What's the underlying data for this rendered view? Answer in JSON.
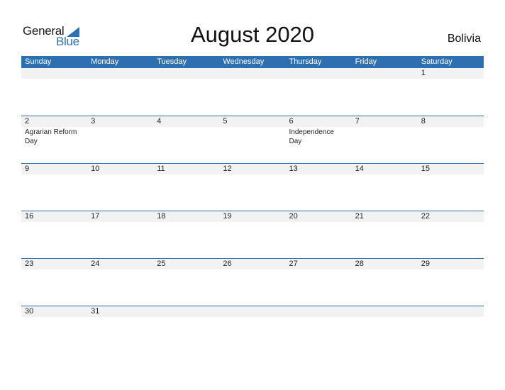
{
  "brand": {
    "word1": "General",
    "word2": "Blue",
    "accent": "#2e6fb2"
  },
  "title": "August 2020",
  "country": "Bolivia",
  "weekdays": [
    "Sunday",
    "Monday",
    "Tuesday",
    "Wednesday",
    "Thursday",
    "Friday",
    "Saturday"
  ],
  "weeks": [
    {
      "days": [
        {
          "num": "",
          "event": ""
        },
        {
          "num": "",
          "event": ""
        },
        {
          "num": "",
          "event": ""
        },
        {
          "num": "",
          "event": ""
        },
        {
          "num": "",
          "event": ""
        },
        {
          "num": "",
          "event": ""
        },
        {
          "num": "1",
          "event": ""
        }
      ]
    },
    {
      "days": [
        {
          "num": "2",
          "event": "Agrarian Reform Day"
        },
        {
          "num": "3",
          "event": ""
        },
        {
          "num": "4",
          "event": ""
        },
        {
          "num": "5",
          "event": ""
        },
        {
          "num": "6",
          "event": "Independence Day"
        },
        {
          "num": "7",
          "event": ""
        },
        {
          "num": "8",
          "event": ""
        }
      ]
    },
    {
      "days": [
        {
          "num": "9",
          "event": ""
        },
        {
          "num": "10",
          "event": ""
        },
        {
          "num": "11",
          "event": ""
        },
        {
          "num": "12",
          "event": ""
        },
        {
          "num": "13",
          "event": ""
        },
        {
          "num": "14",
          "event": ""
        },
        {
          "num": "15",
          "event": ""
        }
      ]
    },
    {
      "days": [
        {
          "num": "16",
          "event": ""
        },
        {
          "num": "17",
          "event": ""
        },
        {
          "num": "18",
          "event": ""
        },
        {
          "num": "19",
          "event": ""
        },
        {
          "num": "20",
          "event": ""
        },
        {
          "num": "21",
          "event": ""
        },
        {
          "num": "22",
          "event": ""
        }
      ]
    },
    {
      "days": [
        {
          "num": "23",
          "event": ""
        },
        {
          "num": "24",
          "event": ""
        },
        {
          "num": "25",
          "event": ""
        },
        {
          "num": "26",
          "event": ""
        },
        {
          "num": "27",
          "event": ""
        },
        {
          "num": "28",
          "event": ""
        },
        {
          "num": "29",
          "event": ""
        }
      ]
    },
    {
      "days": [
        {
          "num": "30",
          "event": ""
        },
        {
          "num": "31",
          "event": ""
        },
        {
          "num": "",
          "event": ""
        },
        {
          "num": "",
          "event": ""
        },
        {
          "num": "",
          "event": ""
        },
        {
          "num": "",
          "event": ""
        },
        {
          "num": "",
          "event": ""
        }
      ]
    }
  ]
}
